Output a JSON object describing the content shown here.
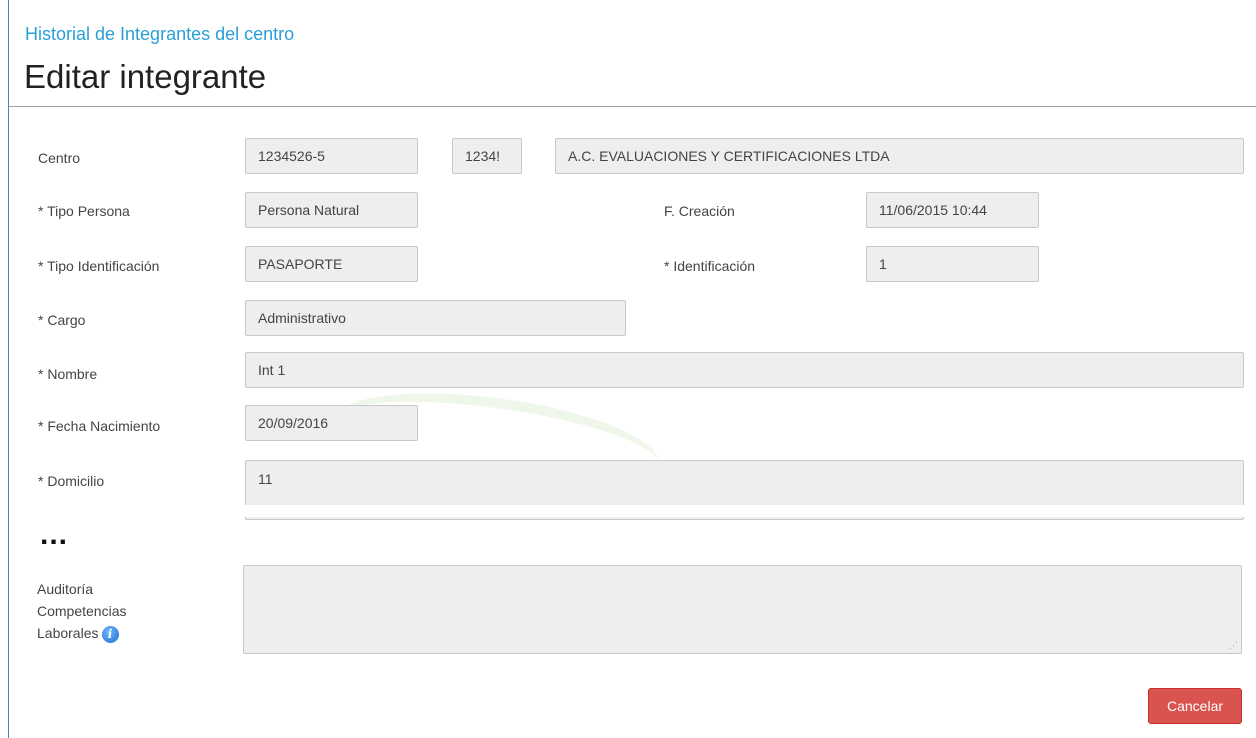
{
  "header": {
    "breadcrumb": "Historial de Integrantes del centro",
    "title": "Editar integrante"
  },
  "form": {
    "centro": {
      "label": "Centro",
      "code": "1234526-5",
      "short_code": "1234!",
      "name": "A.C. EVALUACIONES Y CERTIFICACIONES LTDA"
    },
    "tipo_persona": {
      "label": "* Tipo Persona",
      "value": "Persona Natural"
    },
    "fecha_creacion": {
      "label": "F. Creación",
      "value": "11/06/2015 10:44"
    },
    "tipo_identificacion": {
      "label": "* Tipo Identificación",
      "value": "PASAPORTE"
    },
    "identificacion": {
      "label": "* Identificación",
      "value": "1"
    },
    "cargo": {
      "label": "* Cargo",
      "value": "Administrativo"
    },
    "nombre": {
      "label": "* Nombre",
      "value": "Int 1"
    },
    "fecha_nacimiento": {
      "label": "* Fecha Nacimiento",
      "value": "20/09/2016"
    },
    "domicilio": {
      "label": "* Domicilio",
      "value": "11"
    },
    "ellipsis": "...",
    "auditoria": {
      "label_line1": "Auditoría",
      "label_line2": "Competencias",
      "label_line3": "Laborales",
      "info_icon": "info-icon",
      "value": ""
    }
  },
  "actions": {
    "cancel_label": "Cancelar"
  },
  "colors": {
    "breadcrumb": "#2a9fd6",
    "field_bg": "#eeeeee",
    "cancel_bg": "#d9534f"
  }
}
